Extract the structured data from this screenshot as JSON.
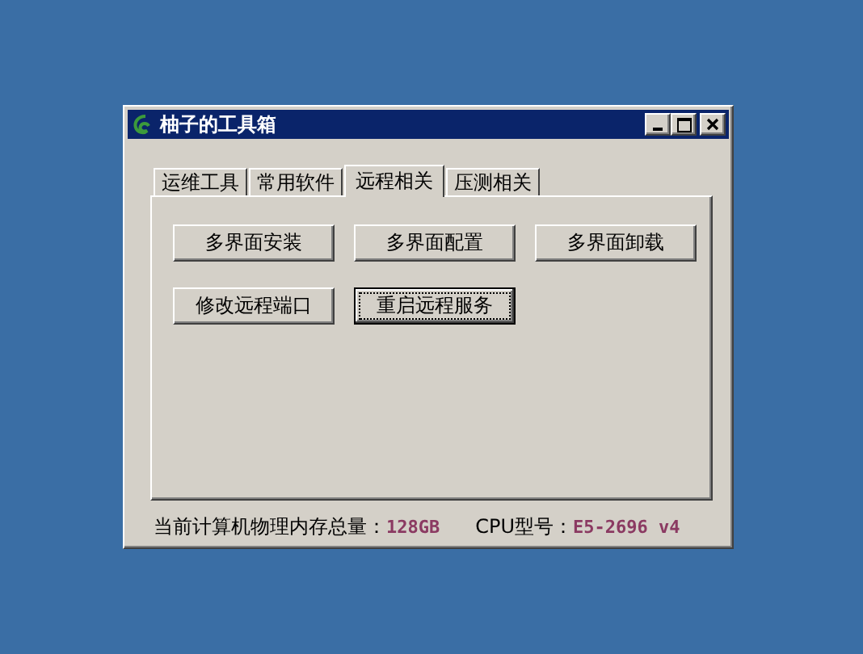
{
  "window": {
    "title": "柚子的工具箱"
  },
  "tabs": [
    {
      "label": "运维工具",
      "selected": false
    },
    {
      "label": "常用软件",
      "selected": false
    },
    {
      "label": "远程相关",
      "selected": true
    },
    {
      "label": "压测相关",
      "selected": false
    }
  ],
  "buttons": [
    {
      "label": "多界面安装",
      "focused": false
    },
    {
      "label": "多界面配置",
      "focused": false
    },
    {
      "label": "多界面卸载",
      "focused": false
    },
    {
      "label": "修改远程端口",
      "focused": false
    },
    {
      "label": "重启远程服务",
      "focused": true
    }
  ],
  "status_bar": [
    {
      "label": "当前计算机物理内存总量：",
      "value": "128GB"
    },
    {
      "label": "CPU型号：",
      "value": "E5-2696 v4"
    }
  ]
}
